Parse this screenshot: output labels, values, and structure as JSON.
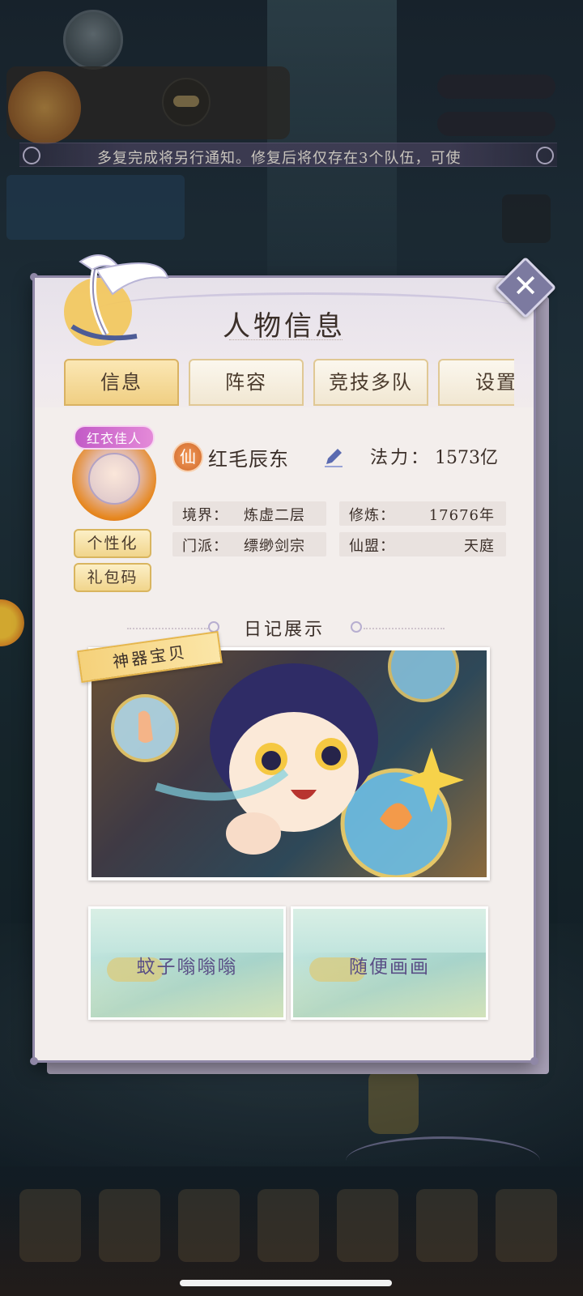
{
  "ticker": {
    "text": "多复完成将另行通知。修复后将仅存在3个队伍，可使"
  },
  "dialog": {
    "title": "人物信息",
    "close_icon": "close-icon",
    "tabs": [
      {
        "label": "信息",
        "active": true
      },
      {
        "label": "阵容",
        "active": false
      },
      {
        "label": "竞技多队",
        "active": false
      },
      {
        "label": "设置",
        "active": false
      }
    ]
  },
  "profile": {
    "avatar_badge": "红衣佳人",
    "personalize_label": "个性化",
    "gift_code_label": "礼包码",
    "rank_icon_text": "仙",
    "name": "红毛辰东",
    "edit_icon": "pencil-icon",
    "power_label": "法力：",
    "power_value": "1573亿",
    "stats": [
      {
        "key": "境界：",
        "value": "炼虚二层"
      },
      {
        "key": "修炼：",
        "value": "17676年"
      },
      {
        "key": "门派：",
        "value": "缥缈剑宗"
      },
      {
        "key": "仙盟：",
        "value": "天庭"
      }
    ]
  },
  "diary": {
    "heading": "日记展示",
    "featured_tag": "神器宝贝",
    "cards": [
      {
        "label": "蚊子嗡嗡嗡"
      },
      {
        "label": "随便画画"
      }
    ]
  },
  "colors": {
    "tab_active": "#f0cf83",
    "tab_border": "#d9b263",
    "panel_bg": "#f3eeec",
    "panel_border": "#8f87a6",
    "close_bg": "#7c7aa0"
  }
}
